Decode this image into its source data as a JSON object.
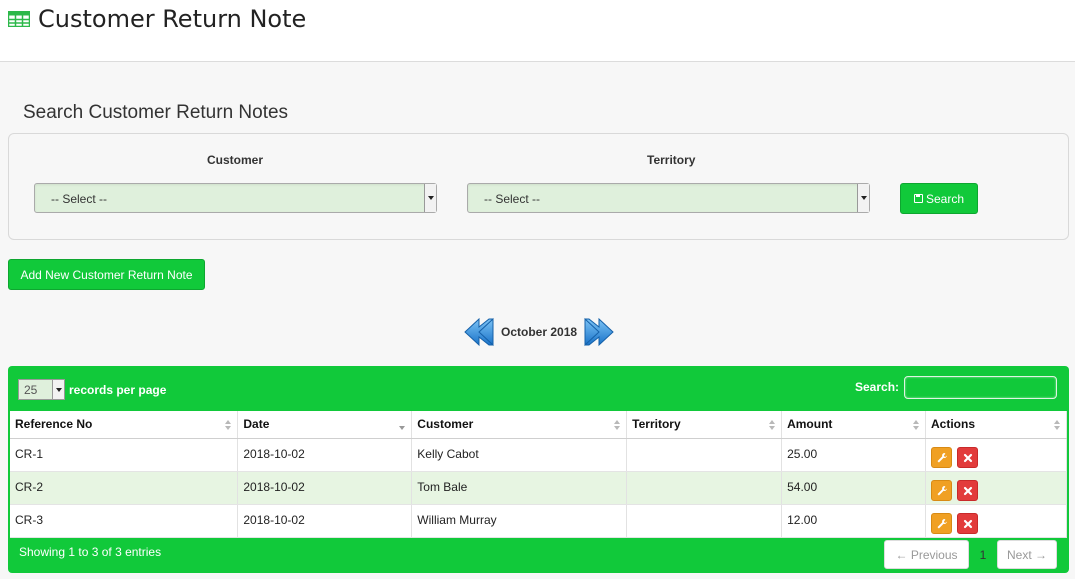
{
  "header": {
    "title": "Customer Return Note",
    "icon": "grid-icon"
  },
  "search_panel": {
    "title": "Search Customer Return Notes",
    "customer_label": "Customer",
    "customer_value": "-- Select --",
    "territory_label": "Territory",
    "territory_value": "-- Select --",
    "search_button": "Search"
  },
  "add_button": "Add New Customer Return Note",
  "month_nav": {
    "label": "October 2018"
  },
  "table": {
    "page_length": "25",
    "page_length_label": "records per page",
    "search_label": "Search:",
    "search_value": "",
    "columns": [
      "Reference No",
      "Date",
      "Customer",
      "Territory",
      "Amount",
      "Actions"
    ],
    "rows": [
      {
        "ref": "CR-1",
        "date": "2018-10-02",
        "customer": "Kelly Cabot",
        "territory": "",
        "amount": "25.00"
      },
      {
        "ref": "CR-2",
        "date": "2018-10-02",
        "customer": "Tom Bale",
        "territory": "",
        "amount": "54.00"
      },
      {
        "ref": "CR-3",
        "date": "2018-10-02",
        "customer": "William Murray",
        "territory": "",
        "amount": "12.00"
      }
    ],
    "info": "Showing 1 to 3 of 3 entries",
    "pagination": {
      "previous": "← Previous",
      "current": "1",
      "next": "Next →"
    }
  },
  "colors": {
    "accent": "#11c93a",
    "select_bg": "#dff0dc",
    "edit": "#f0a023",
    "delete": "#e23b3b"
  }
}
